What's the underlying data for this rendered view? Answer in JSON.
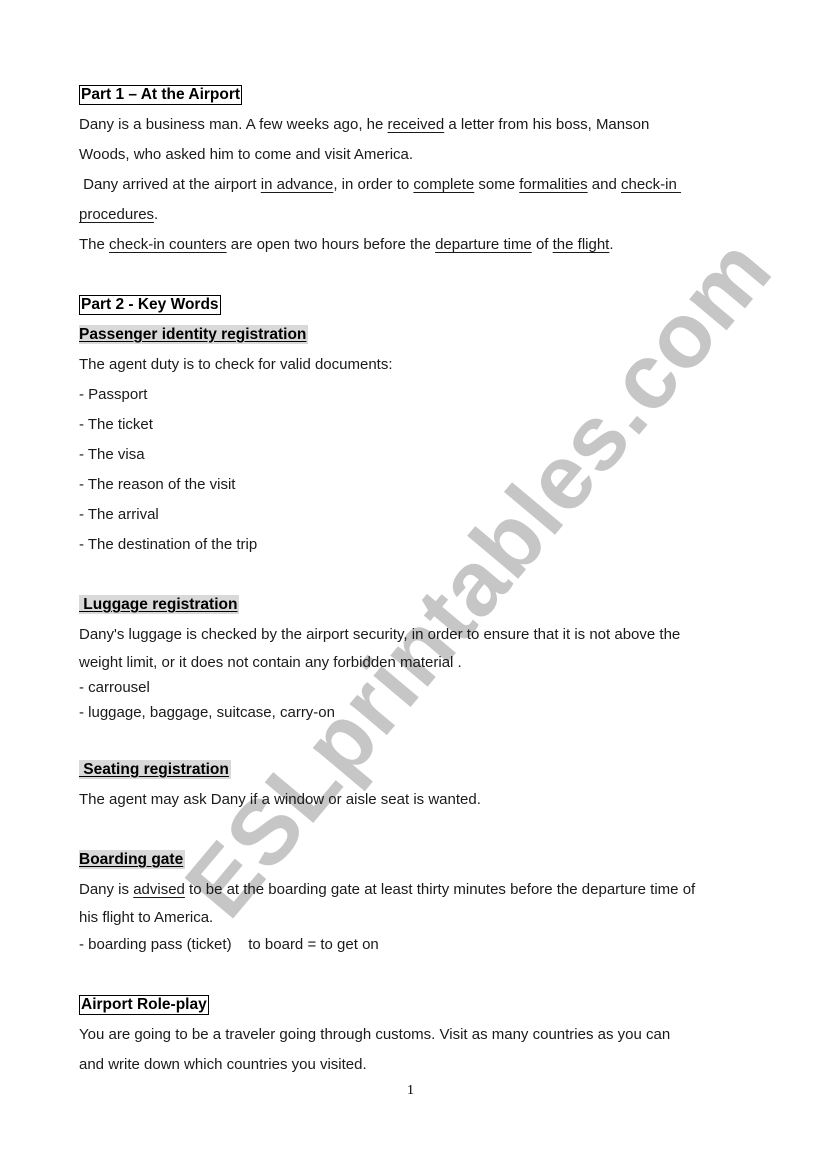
{
  "watermark": "ESLprintables.com",
  "part1": {
    "title": "Part 1 – At the Airport",
    "p1_a": "Dany is a business man. A few weeks ago, he ",
    "p1_u1": "received",
    "p1_b": " a letter from his boss, Manson",
    "p1_c": "Woods, who asked him to come and visit America.",
    "p2_a": " Dany arrived at the airport ",
    "p2_u1": "in advance",
    "p2_b": ", in order to ",
    "p2_u2": "complete",
    "p2_c": " some ",
    "p2_u3": "formalities",
    "p2_d": " and ",
    "p2_u4": "check-in ",
    "p2_u5": "procedures",
    "p2_e": ".",
    "p3_a": "The ",
    "p3_u1": "check-in counters",
    "p3_b": " are open two hours before the ",
    "p3_u2": "departure time",
    "p3_c": " of ",
    "p3_u3": "the flight",
    "p3_d": "."
  },
  "part2": {
    "title": "Part 2 - Key Words",
    "passenger": {
      "heading": "Passenger identity registration",
      "intro": "The agent duty is to check for valid documents:",
      "items": [
        "- Passport",
        "- The ticket",
        "- The visa",
        "- The reason of the visit",
        "- The arrival",
        "- The destination of the trip"
      ]
    },
    "luggage": {
      "heading": " Luggage registration",
      "text1": "Dany's luggage is checked by the airport security, in order to ensure that it is not above the",
      "text2": "weight limit, or it does not contain any forbidden material .",
      "items": [
        "- carrousel",
        "- luggage, baggage, suitcase, carry-on"
      ]
    },
    "seating": {
      "heading": " Seating registration",
      "text": "The agent may ask Dany if a window or aisle seat is wanted."
    },
    "boarding": {
      "heading": "Boarding gate",
      "text_a": "Dany is ",
      "text_u": "advised",
      "text_b": " to be at the boarding gate at least thirty minutes before the departure time of",
      "text2": "his flight to America.",
      "item": "- boarding pass (ticket)    to board = to get on"
    }
  },
  "roleplay": {
    "title": "Airport Role-play",
    "text1": "You are going to be a traveler going through customs. Visit as many countries as you can",
    "text2": "and write down which countries you visited."
  },
  "page_number": "1"
}
